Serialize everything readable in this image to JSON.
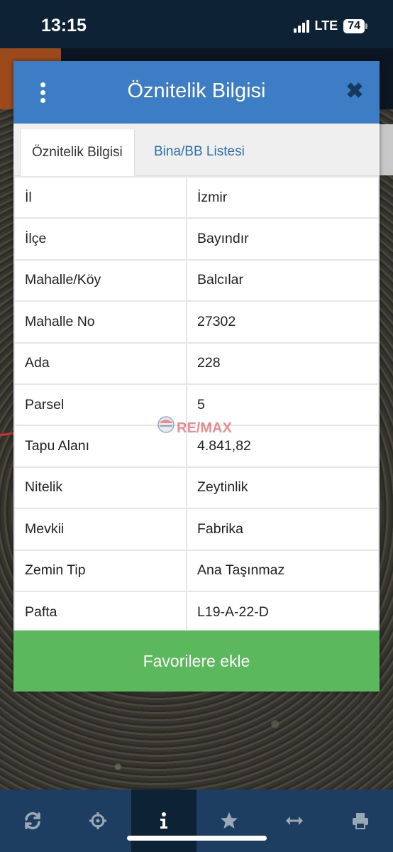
{
  "status_bar": {
    "time": "13:15",
    "network": "LTE",
    "battery": "74"
  },
  "modal": {
    "title": "Öznitelik Bilgisi",
    "tabs": [
      {
        "label": "Öznitelik Bilgisi",
        "active": true
      },
      {
        "label": "Bina/BB Listesi",
        "active": false
      }
    ],
    "rows": [
      {
        "key": "İl",
        "value": "İzmir"
      },
      {
        "key": "İlçe",
        "value": "Bayındır"
      },
      {
        "key": "Mahalle/Köy",
        "value": "Balcılar"
      },
      {
        "key": "Mahalle No",
        "value": "27302"
      },
      {
        "key": "Ada",
        "value": "228"
      },
      {
        "key": "Parsel",
        "value": "5"
      },
      {
        "key": "Tapu Alanı",
        "value": "4.841,82"
      },
      {
        "key": "Nitelik",
        "value": "Zeytinlik"
      },
      {
        "key": "Mevkii",
        "value": "Fabrika"
      },
      {
        "key": "Zemin Tip",
        "value": "Ana Taşınmaz"
      },
      {
        "key": "Pafta",
        "value": "L19-A-22-D"
      }
    ],
    "favorite_button": "Favorilere ekle"
  },
  "watermark": {
    "logo_text": "RE/MAX"
  },
  "bottom_nav": [
    {
      "icon": "refresh-icon",
      "active": false
    },
    {
      "icon": "crosshair-icon",
      "active": false
    },
    {
      "icon": "info-icon",
      "active": true
    },
    {
      "icon": "star-icon",
      "active": false
    },
    {
      "icon": "measure-icon",
      "active": false
    },
    {
      "icon": "print-icon",
      "active": false
    }
  ],
  "colors": {
    "header": "#3d7dc6",
    "favorite_button": "#5cb85c",
    "bottom_bar": "#1d3e60",
    "status_bar": "#0e2236"
  }
}
